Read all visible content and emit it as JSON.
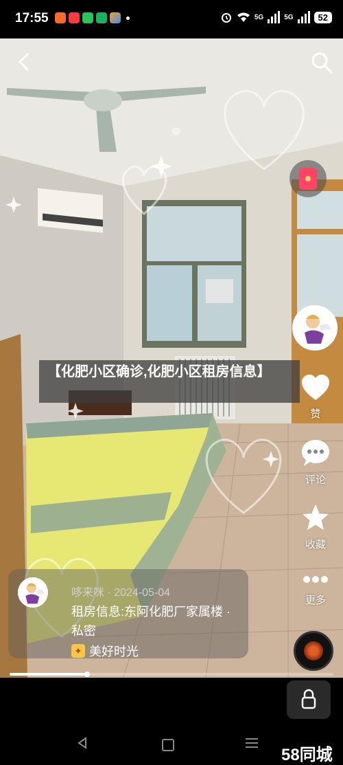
{
  "status_bar": {
    "time": "17:55",
    "network_1": "5G",
    "network_2": "5G",
    "battery": "52"
  },
  "video": {
    "title_banner": "【化肥小区确诊,化肥小区租房信息】"
  },
  "right_rail": {
    "like_label": "赞",
    "comment_label": "评论",
    "favorite_label": "收藏",
    "more_label": "更多"
  },
  "author": {
    "name_date": "哆来咪 · 2024-05-04",
    "description": "租房信息:东阿化肥厂家属楼 · 私密",
    "tag": "美好时光"
  },
  "progress": {
    "fraction": 0.24
  },
  "watermark": "58同城"
}
